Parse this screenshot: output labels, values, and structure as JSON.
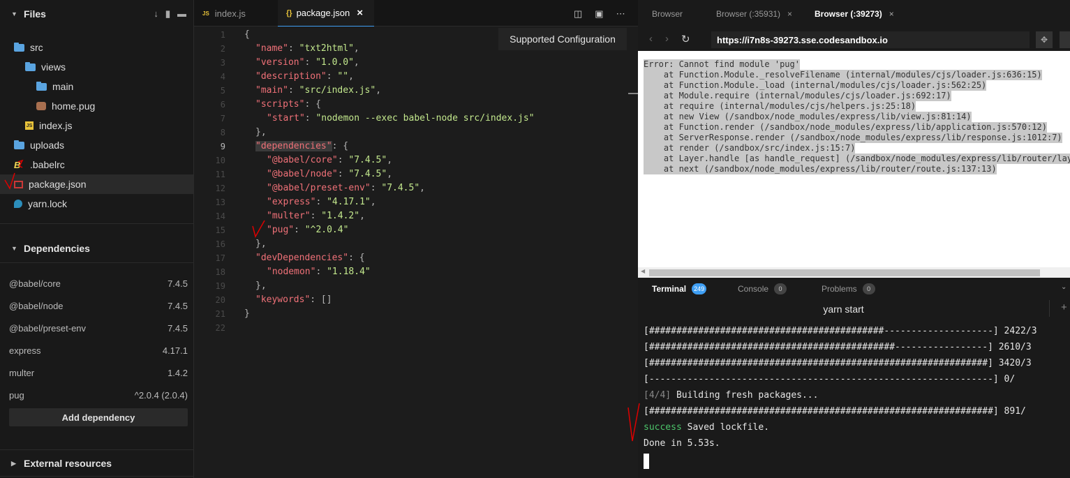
{
  "sidebar": {
    "files_title": "Files",
    "tree": [
      {
        "label": "src",
        "type": "folder"
      },
      {
        "label": "views",
        "type": "folder"
      },
      {
        "label": "main",
        "type": "folder"
      },
      {
        "label": "home.pug",
        "type": "pug"
      },
      {
        "label": "index.js",
        "type": "js"
      },
      {
        "label": "uploads",
        "type": "folder"
      },
      {
        "label": ".babelrc",
        "type": "babel"
      },
      {
        "label": "package.json",
        "type": "npm"
      },
      {
        "label": "yarn.lock",
        "type": "yarn"
      }
    ],
    "dependencies_title": "Dependencies",
    "dependencies": [
      {
        "name": "@babel/core",
        "version": "7.4.5"
      },
      {
        "name": "@babel/node",
        "version": "7.4.5"
      },
      {
        "name": "@babel/preset-env",
        "version": "7.4.5"
      },
      {
        "name": "express",
        "version": "4.17.1"
      },
      {
        "name": "multer",
        "version": "1.4.2"
      },
      {
        "name": "pug",
        "version": "^2.0.4 (2.0.4)"
      }
    ],
    "add_dependency_label": "Add dependency",
    "external_title": "External resources"
  },
  "editor": {
    "tabs": [
      {
        "label": "index.js",
        "icon": "JS"
      },
      {
        "label": "package.json",
        "icon": "{}",
        "close": "×"
      }
    ],
    "tooltip": "Supported Configuration",
    "lines": [
      "1",
      "2",
      "3",
      "4",
      "5",
      "6",
      "7",
      "8",
      "9",
      "10",
      "11",
      "12",
      "13",
      "14",
      "15",
      "16",
      "17",
      "18",
      "19",
      "20",
      "21",
      "22"
    ],
    "code": [
      {
        "c": "p",
        "t": "{"
      },
      {
        "k": "\"name\"",
        "p": ": ",
        "s": "\"txt2html\"",
        "e": ","
      },
      {
        "k": "\"version\"",
        "p": ": ",
        "s": "\"1.0.0\"",
        "e": ","
      },
      {
        "k": "\"description\"",
        "p": ": ",
        "s": "\"\"",
        "e": ","
      },
      {
        "k": "\"main\"",
        "p": ": ",
        "s": "\"src/index.js\"",
        "e": ","
      },
      {
        "k": "\"scripts\"",
        "p": ": {",
        "s": "",
        "e": ""
      },
      {
        "k": "\"start\"",
        "p": ": ",
        "s": "\"nodemon --exec babel-node src/index.js\"",
        "e": ""
      },
      {
        "c": "p",
        "t": "},"
      },
      {
        "k": "\"dependencies\"",
        "p": ": {",
        "s": "",
        "e": ""
      },
      {
        "k": "\"@babel/core\"",
        "p": ": ",
        "s": "\"7.4.5\"",
        "e": ","
      },
      {
        "k": "\"@babel/node\"",
        "p": ": ",
        "s": "\"7.4.5\"",
        "e": ","
      },
      {
        "k": "\"@babel/preset-env\"",
        "p": ": ",
        "s": "\"7.4.5\"",
        "e": ","
      },
      {
        "k": "\"express\"",
        "p": ": ",
        "s": "\"4.17.1\"",
        "e": ","
      },
      {
        "k": "\"multer\"",
        "p": ": ",
        "s": "\"1.4.2\"",
        "e": ","
      },
      {
        "k": "\"pug\"",
        "p": ": ",
        "s": "\"^2.0.4\"",
        "e": ""
      },
      {
        "c": "p",
        "t": "},"
      },
      {
        "k": "\"devDependencies\"",
        "p": ": {",
        "s": "",
        "e": ""
      },
      {
        "k": "\"nodemon\"",
        "p": ": ",
        "s": "\"1.18.4\"",
        "e": ""
      },
      {
        "c": "p",
        "t": "},"
      },
      {
        "k": "\"keywords\"",
        "p": ": []",
        "s": "",
        "e": ""
      },
      {
        "c": "p",
        "t": "}"
      },
      {
        "c": "p",
        "t": ""
      }
    ]
  },
  "browser": {
    "tabs": [
      {
        "label": "Browser"
      },
      {
        "label": "Browser (:35931)",
        "close": "×"
      },
      {
        "label": "Browser (:39273)",
        "close": "×"
      }
    ],
    "url": "https://i7n8s-39273.sse.codesandbox.io",
    "error_lines": [
      "Error: Cannot find module 'pug'",
      "    at Function.Module._resolveFilename (internal/modules/cjs/loader.js:636:15)",
      "    at Function.Module._load (internal/modules/cjs/loader.js:562:25)",
      "    at Module.require (internal/modules/cjs/loader.js:692:17)",
      "    at require (internal/modules/cjs/helpers.js:25:18)",
      "    at new View (/sandbox/node_modules/express/lib/view.js:81:14)",
      "    at Function.render (/sandbox/node_modules/express/lib/application.js:570:12)",
      "    at ServerResponse.render (/sandbox/node_modules/express/lib/response.js:1012:7)",
      "    at render (/sandbox/src/index.js:15:7)",
      "    at Layer.handle [as handle_request] (/sandbox/node_modules/express/lib/router/layer",
      "    at next (/sandbox/node_modules/express/lib/router/route.js:137:13)"
    ]
  },
  "terminal": {
    "tabs": [
      {
        "label": "Terminal",
        "count": "249"
      },
      {
        "label": "Console",
        "count": "0"
      },
      {
        "label": "Problems",
        "count": "0"
      }
    ],
    "title": "yarn start",
    "add": "+",
    "lines": [
      "[###########################################--------------------] 2422/3",
      "[#############################################-----------------] 2610/3",
      "[##############################################################] 3420/3",
      "[---------------------------------------------------------------] 0/",
      "",
      "[###############################################################] 891/",
      "",
      "Done in 5.53s."
    ],
    "building_prefix": "[4/4]",
    "building_text": " Building fresh packages...",
    "success_word": "success",
    "success_text": " Saved lockfile."
  }
}
